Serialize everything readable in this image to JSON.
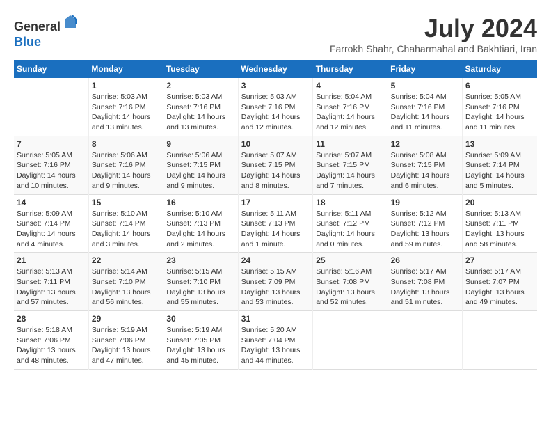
{
  "header": {
    "logo_line1": "General",
    "logo_line2": "Blue",
    "month": "July 2024",
    "location": "Farrokh Shahr, Chaharmahal and Bakhtiari, Iran"
  },
  "weekdays": [
    "Sunday",
    "Monday",
    "Tuesday",
    "Wednesday",
    "Thursday",
    "Friday",
    "Saturday"
  ],
  "weeks": [
    [
      {
        "day": "",
        "info": ""
      },
      {
        "day": "1",
        "info": "Sunrise: 5:03 AM\nSunset: 7:16 PM\nDaylight: 14 hours\nand 13 minutes."
      },
      {
        "day": "2",
        "info": "Sunrise: 5:03 AM\nSunset: 7:16 PM\nDaylight: 14 hours\nand 13 minutes."
      },
      {
        "day": "3",
        "info": "Sunrise: 5:03 AM\nSunset: 7:16 PM\nDaylight: 14 hours\nand 12 minutes."
      },
      {
        "day": "4",
        "info": "Sunrise: 5:04 AM\nSunset: 7:16 PM\nDaylight: 14 hours\nand 12 minutes."
      },
      {
        "day": "5",
        "info": "Sunrise: 5:04 AM\nSunset: 7:16 PM\nDaylight: 14 hours\nand 11 minutes."
      },
      {
        "day": "6",
        "info": "Sunrise: 5:05 AM\nSunset: 7:16 PM\nDaylight: 14 hours\nand 11 minutes."
      }
    ],
    [
      {
        "day": "7",
        "info": "Sunrise: 5:05 AM\nSunset: 7:16 PM\nDaylight: 14 hours\nand 10 minutes."
      },
      {
        "day": "8",
        "info": "Sunrise: 5:06 AM\nSunset: 7:16 PM\nDaylight: 14 hours\nand 9 minutes."
      },
      {
        "day": "9",
        "info": "Sunrise: 5:06 AM\nSunset: 7:15 PM\nDaylight: 14 hours\nand 9 minutes."
      },
      {
        "day": "10",
        "info": "Sunrise: 5:07 AM\nSunset: 7:15 PM\nDaylight: 14 hours\nand 8 minutes."
      },
      {
        "day": "11",
        "info": "Sunrise: 5:07 AM\nSunset: 7:15 PM\nDaylight: 14 hours\nand 7 minutes."
      },
      {
        "day": "12",
        "info": "Sunrise: 5:08 AM\nSunset: 7:15 PM\nDaylight: 14 hours\nand 6 minutes."
      },
      {
        "day": "13",
        "info": "Sunrise: 5:09 AM\nSunset: 7:14 PM\nDaylight: 14 hours\nand 5 minutes."
      }
    ],
    [
      {
        "day": "14",
        "info": "Sunrise: 5:09 AM\nSunset: 7:14 PM\nDaylight: 14 hours\nand 4 minutes."
      },
      {
        "day": "15",
        "info": "Sunrise: 5:10 AM\nSunset: 7:14 PM\nDaylight: 14 hours\nand 3 minutes."
      },
      {
        "day": "16",
        "info": "Sunrise: 5:10 AM\nSunset: 7:13 PM\nDaylight: 14 hours\nand 2 minutes."
      },
      {
        "day": "17",
        "info": "Sunrise: 5:11 AM\nSunset: 7:13 PM\nDaylight: 14 hours\nand 1 minute."
      },
      {
        "day": "18",
        "info": "Sunrise: 5:11 AM\nSunset: 7:12 PM\nDaylight: 14 hours\nand 0 minutes."
      },
      {
        "day": "19",
        "info": "Sunrise: 5:12 AM\nSunset: 7:12 PM\nDaylight: 13 hours\nand 59 minutes."
      },
      {
        "day": "20",
        "info": "Sunrise: 5:13 AM\nSunset: 7:11 PM\nDaylight: 13 hours\nand 58 minutes."
      }
    ],
    [
      {
        "day": "21",
        "info": "Sunrise: 5:13 AM\nSunset: 7:11 PM\nDaylight: 13 hours\nand 57 minutes."
      },
      {
        "day": "22",
        "info": "Sunrise: 5:14 AM\nSunset: 7:10 PM\nDaylight: 13 hours\nand 56 minutes."
      },
      {
        "day": "23",
        "info": "Sunrise: 5:15 AM\nSunset: 7:10 PM\nDaylight: 13 hours\nand 55 minutes."
      },
      {
        "day": "24",
        "info": "Sunrise: 5:15 AM\nSunset: 7:09 PM\nDaylight: 13 hours\nand 53 minutes."
      },
      {
        "day": "25",
        "info": "Sunrise: 5:16 AM\nSunset: 7:08 PM\nDaylight: 13 hours\nand 52 minutes."
      },
      {
        "day": "26",
        "info": "Sunrise: 5:17 AM\nSunset: 7:08 PM\nDaylight: 13 hours\nand 51 minutes."
      },
      {
        "day": "27",
        "info": "Sunrise: 5:17 AM\nSunset: 7:07 PM\nDaylight: 13 hours\nand 49 minutes."
      }
    ],
    [
      {
        "day": "28",
        "info": "Sunrise: 5:18 AM\nSunset: 7:06 PM\nDaylight: 13 hours\nand 48 minutes."
      },
      {
        "day": "29",
        "info": "Sunrise: 5:19 AM\nSunset: 7:06 PM\nDaylight: 13 hours\nand 47 minutes."
      },
      {
        "day": "30",
        "info": "Sunrise: 5:19 AM\nSunset: 7:05 PM\nDaylight: 13 hours\nand 45 minutes."
      },
      {
        "day": "31",
        "info": "Sunrise: 5:20 AM\nSunset: 7:04 PM\nDaylight: 13 hours\nand 44 minutes."
      },
      {
        "day": "",
        "info": ""
      },
      {
        "day": "",
        "info": ""
      },
      {
        "day": "",
        "info": ""
      }
    ]
  ]
}
